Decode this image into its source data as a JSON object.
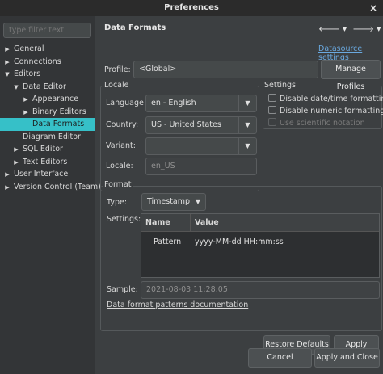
{
  "window": {
    "title": "Preferences",
    "close": "×"
  },
  "sidebar": {
    "filter_placeholder": "type filter text",
    "items": [
      {
        "label": "General",
        "toggle": "▶"
      },
      {
        "label": "Connections",
        "toggle": "▶"
      },
      {
        "label": "Editors",
        "toggle": "▼"
      },
      {
        "label": "Data Editor",
        "toggle": "▼"
      },
      {
        "label": "Appearance",
        "toggle": "▶"
      },
      {
        "label": "Binary Editors",
        "toggle": "▶"
      },
      {
        "label": "Data Formats",
        "toggle": ""
      },
      {
        "label": "Diagram Editor",
        "toggle": ""
      },
      {
        "label": "SQL Editor",
        "toggle": "▶"
      },
      {
        "label": "Text Editors",
        "toggle": "▶"
      },
      {
        "label": "User Interface",
        "toggle": "▶"
      },
      {
        "label": "Version Control (Team)",
        "toggle": "▶"
      }
    ]
  },
  "main": {
    "title": "Data Formats",
    "nav": {
      "back": "🡐 ▾",
      "forward": "🡒 ▾",
      "menu": "⋮"
    },
    "datasource_link": "Datasource settings",
    "profile": {
      "label": "Profile:",
      "value": "<Global>",
      "manage_button": "Manage Profiles"
    },
    "locale": {
      "title": "Locale",
      "language_label": "Language:",
      "language_value": "en - English",
      "country_label": "Country:",
      "country_value": "US - United States",
      "variant_label": "Variant:",
      "variant_value": "",
      "locale_label": "Locale:",
      "locale_value": "en_US"
    },
    "settings": {
      "title": "Settings",
      "disable_datetime": "Disable date/time formatting",
      "disable_numeric": "Disable numeric formatting",
      "use_scientific": "Use scientific notation"
    },
    "format": {
      "title": "Format",
      "type_label": "Type:",
      "type_value": "Timestamp",
      "settings_label": "Settings:",
      "col_name": "Name",
      "col_value": "Value",
      "row_name": "Pattern",
      "row_value": "yyyy-MM-dd HH:mm:ss",
      "sample_label": "Sample:",
      "sample_value": "2021-08-03 11:28:05",
      "doc_link": "Data format patterns documentation"
    },
    "buttons": {
      "restore": "Restore Defaults",
      "apply": "Apply",
      "cancel": "Cancel",
      "apply_close": "Apply and Close"
    }
  },
  "colors": {
    "selected": "#36c0c8",
    "link": "#6aa9e0",
    "background": "#3c3f41"
  }
}
